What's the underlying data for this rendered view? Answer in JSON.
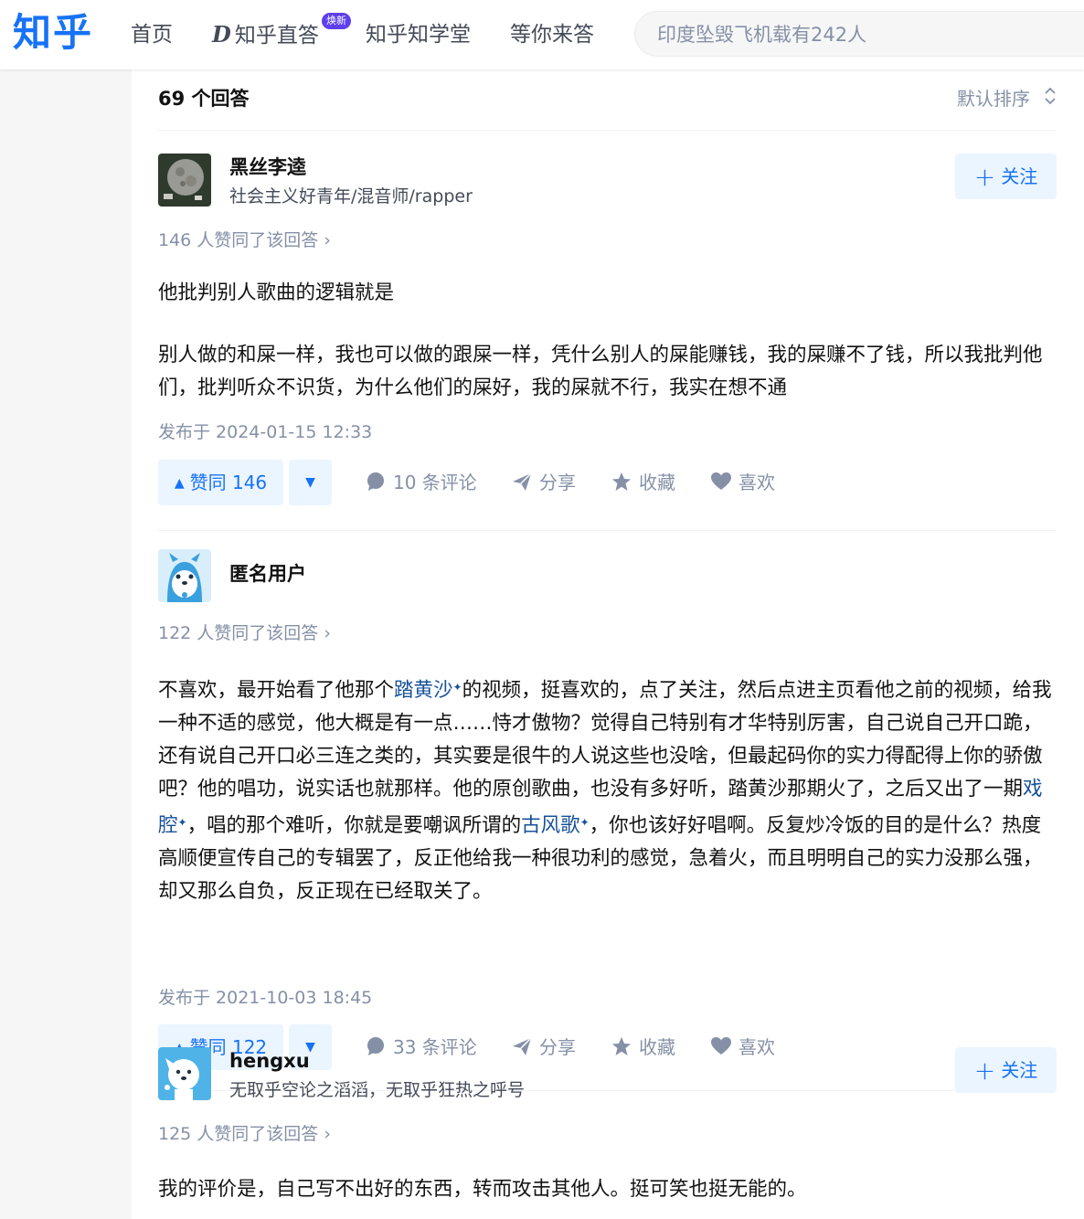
{
  "header": {
    "logo": "知乎",
    "nav": {
      "home": "首页",
      "zhida": "知乎直答",
      "zhida_badge": "焕新",
      "xuetang": "知乎知学堂",
      "waiting": "等你来答"
    },
    "search": {
      "placeholder": "印度坠毁飞机载有242人"
    }
  },
  "list": {
    "answer_count": "69 个回答",
    "sort_label": "默认排序"
  },
  "answers": [
    {
      "author": {
        "name": "黑丝李逵",
        "bio": "社会主义好青年/混音师/rapper"
      },
      "follow_label": "关注",
      "vote_summary": "146 人赞同了该回答 ›",
      "paragraphs": [
        "他批判别人歌曲的逻辑就是",
        "别人做的和屎一样，我也可以做的跟屎一样，凭什么别人的屎能赚钱，我的屎赚不了钱，所以我批判他们，批判听众不识货，为什么他们的屎好，我的屎就不行，我实在想不通"
      ],
      "published": "发布于 2024-01-15 12:33",
      "actions": {
        "upvote": "赞同 146",
        "comments": "10 条评论",
        "share": "分享",
        "collect": "收藏",
        "like": "喜欢"
      }
    },
    {
      "author": {
        "name": "匿名用户"
      },
      "vote_summary": "122 人赞同了该回答 ›",
      "body": {
        "t1": "不喜欢，最开始看了他那个",
        "link1": "踏黄沙",
        "t2": "的视频，挺喜欢的，点了关注，然后点进主页看他之前的视频，给我一种不适的感觉，他大概是有一点……恃才傲物？觉得自己特别有才华特别厉害，自己说自己开口跪，还有说自己开口必三连之类的，其实要是很牛的人说这些也没啥，但最起码你的实力得配得上你的骄傲吧？他的唱功，说实话也就那样。他的原创歌曲，也没有多好听，踏黄沙那期火了，之后又出了一期",
        "link2": "戏腔",
        "t3": "，唱的那个难听，你就是要嘲讽所谓的",
        "link3": "古风歌",
        "t4": "，你也该好好唱啊。反复炒冷饭的目的是什么？热度高顺便宣传自己的专辑罢了，反正他给我一种很功利的感觉，急着火，而且明明自己的实力没那么强，却又那么自负，反正现在已经取关了。"
      },
      "published": "发布于 2021-10-03 18:45",
      "actions": {
        "upvote": "赞同 122",
        "comments": "33 条评论",
        "share": "分享",
        "collect": "收藏",
        "like": "喜欢"
      }
    },
    {
      "author": {
        "name": "hengxu",
        "bio": "无取乎空论之滔滔，无取乎狂热之呼号"
      },
      "follow_label": "关注",
      "vote_summary": "125 人赞同了该回答 ›",
      "paragraphs": [
        "我的评价是，自己写不出好的东西，转而攻击其他人。挺可笑也挺无能的。"
      ]
    }
  ]
}
